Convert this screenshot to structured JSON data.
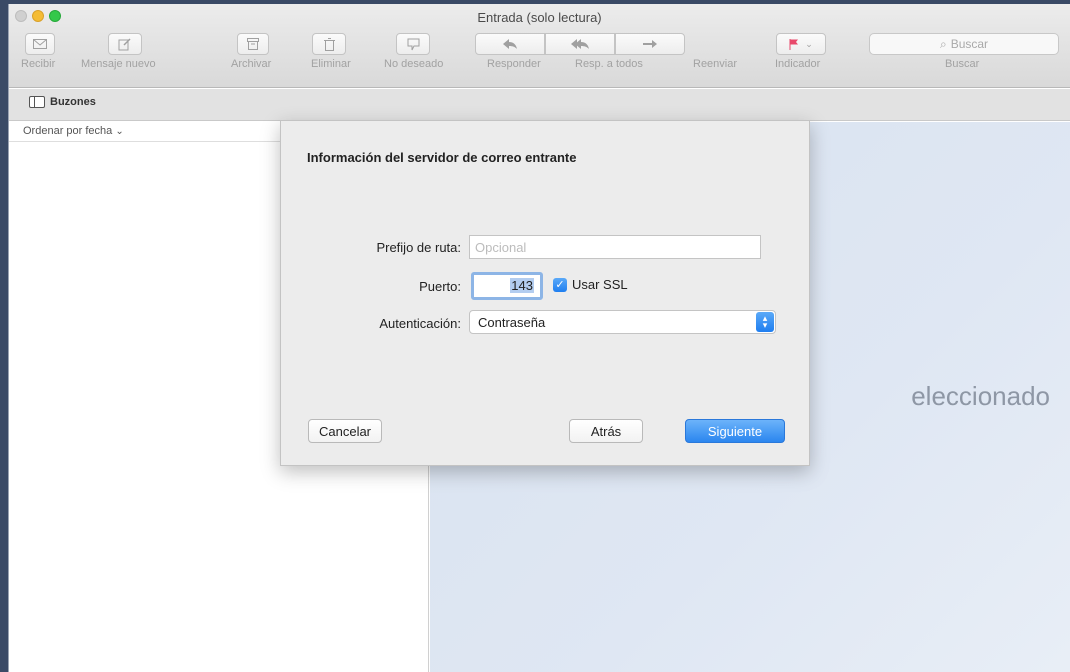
{
  "window": {
    "title": "Entrada (solo lectura)"
  },
  "toolbar": {
    "receive": {
      "label": "Recibir",
      "icon": "envelope-icon"
    },
    "new_message": {
      "label": "Mensaje nuevo",
      "icon": "compose-icon"
    },
    "archive": {
      "label": "Archivar",
      "icon": "archive-icon"
    },
    "delete": {
      "label": "Eliminar",
      "icon": "trash-icon"
    },
    "junk": {
      "label": "No deseado",
      "icon": "junk-icon"
    },
    "reply": {
      "label": "Responder",
      "icon": "reply-icon"
    },
    "reply_all": {
      "label": "Resp. a todos",
      "icon": "reply-all-icon"
    },
    "forward": {
      "label": "Reenviar",
      "icon": "forward-icon"
    },
    "flag": {
      "label": "Indicador",
      "icon": "flag-icon"
    },
    "search": {
      "placeholder": "Buscar",
      "label": "Buscar",
      "icon": "search-icon"
    }
  },
  "mailbar": {
    "mailboxes_label": "Buzones"
  },
  "list": {
    "sort_label": "Ordenar por fecha"
  },
  "viewer": {
    "empty_text": "eleccionado"
  },
  "sheet": {
    "title": "Información del servidor de correo entrante",
    "path_prefix": {
      "label": "Prefijo de ruta:",
      "placeholder": "Opcional",
      "value": ""
    },
    "port": {
      "label": "Puerto:",
      "value": "143"
    },
    "ssl": {
      "label": "Usar SSL",
      "checked": true
    },
    "auth": {
      "label": "Autenticación:",
      "value": "Contraseña"
    },
    "buttons": {
      "cancel": "Cancelar",
      "back": "Atrás",
      "next": "Siguiente"
    }
  },
  "colors": {
    "accent": "#2b86ef",
    "flag": "#e8486a"
  }
}
